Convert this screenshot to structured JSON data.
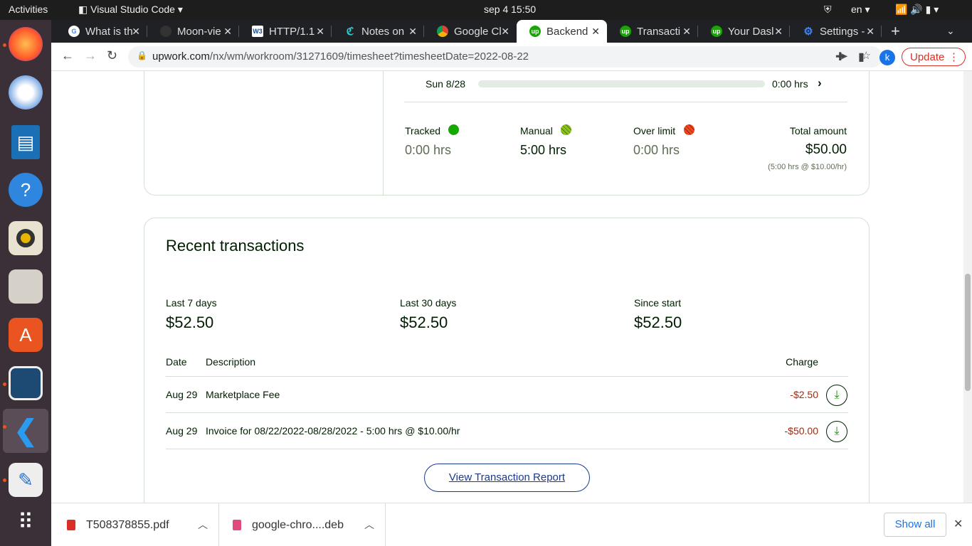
{
  "system": {
    "activities": "Activities",
    "app": "Visual Studio Code",
    "clock": "sep 4  15:50",
    "lang": "en"
  },
  "dock": [
    "firefox-icon",
    "thunderbird-icon",
    "writer-icon",
    "help-icon",
    "rhythmbox-icon",
    "files-icon",
    "software-icon",
    "shotwell-icon",
    "vscode-icon",
    "text-editor-icon",
    "apps-grid-icon"
  ],
  "tabs": [
    {
      "title": "What is th",
      "icon": "google"
    },
    {
      "title": "Moon-vie",
      "icon": "github"
    },
    {
      "title": "HTTP/1.1",
      "icon": "w3"
    },
    {
      "title": "Notes on",
      "icon": "notes"
    },
    {
      "title": "Google Cl",
      "icon": "chrome"
    },
    {
      "title": "Backend",
      "icon": "upwork"
    },
    {
      "title": "Transacti",
      "icon": "upwork"
    },
    {
      "title": "Your Dasl",
      "icon": "upwork"
    },
    {
      "title": "Settings -",
      "icon": "settings"
    }
  ],
  "url": {
    "domain": "upwork.com",
    "path": "/nx/wm/workroom/31271609/timesheet?timesheetDate=2022-08-22"
  },
  "profile": "k",
  "update": "Update",
  "timesheet": {
    "day": "Sun 8/28",
    "day_hours": "0:00 hrs",
    "day_progress": 0,
    "stats": [
      {
        "label": "Tracked",
        "value": "0:00 hrs",
        "color": "#14a800"
      },
      {
        "label": "Manual",
        "value": "5:00 hrs",
        "color": "#8bc31a"
      },
      {
        "label": "Over limit",
        "value": "0:00 hrs",
        "color": "#f1481f"
      }
    ],
    "total_label": "Total amount",
    "total": "$50.00",
    "total_note": "(5:00 hrs @ $10.00/hr)"
  },
  "transactions": {
    "title": "Recent transactions",
    "summary": [
      {
        "label": "Last 7 days",
        "value": "$52.50"
      },
      {
        "label": "Last 30 days",
        "value": "$52.50"
      },
      {
        "label": "Since start",
        "value": "$52.50"
      }
    ],
    "headers": {
      "date": "Date",
      "desc": "Description",
      "charge": "Charge"
    },
    "rows": [
      {
        "date": "Aug 29",
        "desc": "Marketplace Fee",
        "charge": "-$2.50"
      },
      {
        "date": "Aug 29",
        "desc": "Invoice for 08/22/2022-08/28/2022 - 5:00 hrs @ $10.00/hr",
        "charge": "-$50.00"
      }
    ],
    "report": "View Transaction Report"
  },
  "downloads": [
    {
      "name": "T508378855.pdf"
    },
    {
      "name": "google-chro....deb"
    }
  ],
  "show_all": "Show all"
}
